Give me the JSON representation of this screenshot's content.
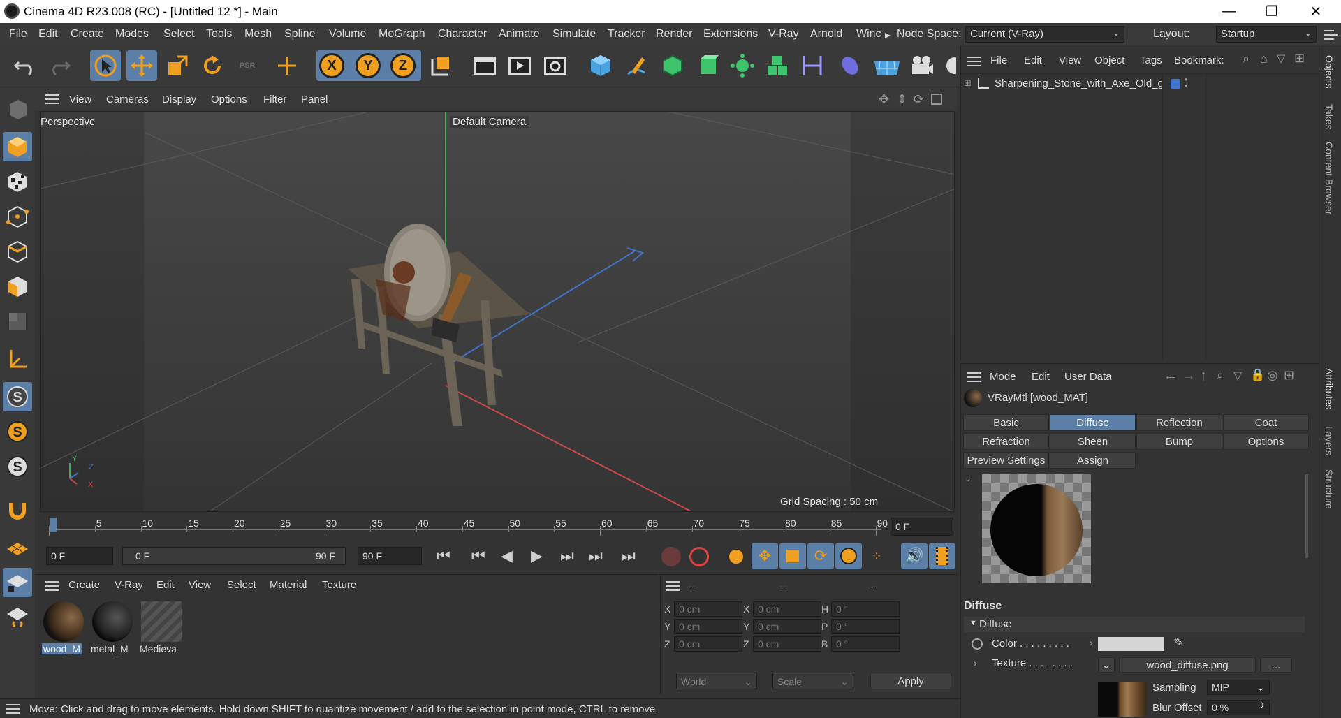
{
  "window": {
    "title": "Cinema 4D R23.008 (RC) - [Untitled 12 *] - Main",
    "minimize_icon": "—",
    "restore_icon": "❐",
    "close_icon": "✕"
  },
  "menubar": {
    "items": [
      "File",
      "Edit",
      "Create",
      "Modes",
      "Select",
      "Tools",
      "Mesh",
      "Spline",
      "Volume",
      "MoGraph",
      "Character",
      "Animate",
      "Simulate",
      "Tracker",
      "Render",
      "Extensions",
      "V-Ray",
      "Arnold",
      "Winc"
    ],
    "overflow_arrow": "▸",
    "node_space_label": "Node Space:",
    "node_space_value": "Current (V-Ray)",
    "layout_label": "Layout:",
    "layout_value": "Startup"
  },
  "toolbar": {
    "psr_label": "PSR",
    "axis_x": "X",
    "axis_y": "Y",
    "axis_z": "Z"
  },
  "viewport": {
    "menu": [
      "View",
      "Cameras",
      "Display",
      "Options",
      "Filter",
      "Panel"
    ],
    "name": "Perspective",
    "camera": "Default Camera",
    "grid_spacing": "Grid Spacing : 50 cm",
    "axis_labels": {
      "x": "X",
      "y": "Y",
      "z": "Z"
    }
  },
  "timeline": {
    "ticks": [
      "0",
      "5",
      "10",
      "15",
      "20",
      "25",
      "30",
      "35",
      "40",
      "45",
      "50",
      "55",
      "60",
      "65",
      "70",
      "75",
      "80",
      "85",
      "90"
    ],
    "current_frame": "0 F"
  },
  "transport": {
    "start_frame": "0 F",
    "range_start": "0 F",
    "range_end": "90 F",
    "end_frame": "90 F"
  },
  "material_manager": {
    "menu": [
      "Create",
      "V-Ray",
      "Edit",
      "View",
      "Select",
      "Material",
      "Texture"
    ],
    "materials": [
      {
        "name": "wood_M"
      },
      {
        "name": "metal_M"
      },
      {
        "name": "Medieva"
      }
    ]
  },
  "coordinates": {
    "headers": [
      "--",
      "--",
      "--"
    ],
    "rows": [
      {
        "l1": "X",
        "v1": "0 cm",
        "l2": "X",
        "v2": "0 cm",
        "l3": "H",
        "v3": "0 °"
      },
      {
        "l1": "Y",
        "v1": "0 cm",
        "l2": "Y",
        "v2": "0 cm",
        "l3": "P",
        "v3": "0 °"
      },
      {
        "l1": "Z",
        "v1": "0 cm",
        "l2": "Z",
        "v2": "0 cm",
        "l3": "B",
        "v3": "0 °"
      }
    ],
    "space": "World",
    "mode": "Scale",
    "apply": "Apply"
  },
  "object_manager": {
    "menu": [
      "File",
      "Edit",
      "View",
      "Object",
      "Tags",
      "Bookmark:"
    ],
    "objects": [
      {
        "name": "Sharpening_Stone_with_Axe_Old_g"
      }
    ]
  },
  "attribute_manager": {
    "menu": [
      "Mode",
      "Edit",
      "User Data"
    ],
    "material_title": "VRayMtl [wood_MAT]",
    "tabs_row1": [
      "Basic",
      "Diffuse",
      "Reflection",
      "Coat"
    ],
    "tabs_row2": [
      "Refraction",
      "Sheen",
      "Bump",
      "Options"
    ],
    "tabs_row3": [
      "Preview Settings",
      "Assign"
    ],
    "active_tab": "Diffuse",
    "section_title": "Diffuse",
    "group_title": "Diffuse",
    "color_label": "Color . . . . . . . . .",
    "texture_label": "Texture . . . . . . . .",
    "texture_file": "wood_diffuse.png",
    "more_button": "...",
    "sampling_label": "Sampling",
    "sampling_value": "MIP",
    "blur_label": "Blur Offset",
    "blur_value": "0 %",
    "color_swatch": "#d6d6d6"
  },
  "right_tabs": [
    "Objects",
    "Takes",
    "Content Browser",
    "Attributes",
    "Layers",
    "Structure"
  ],
  "status": {
    "text": "Move: Click and drag to move elements. Hold down SHIFT to quantize movement / add to the selection in point mode, CTRL to remove."
  },
  "colors": {
    "accent": "#5b7fa6",
    "panel": "#333333",
    "x_axis": "#c84a4a",
    "y_axis": "#3fae5a",
    "z_axis": "#3e74c9"
  }
}
